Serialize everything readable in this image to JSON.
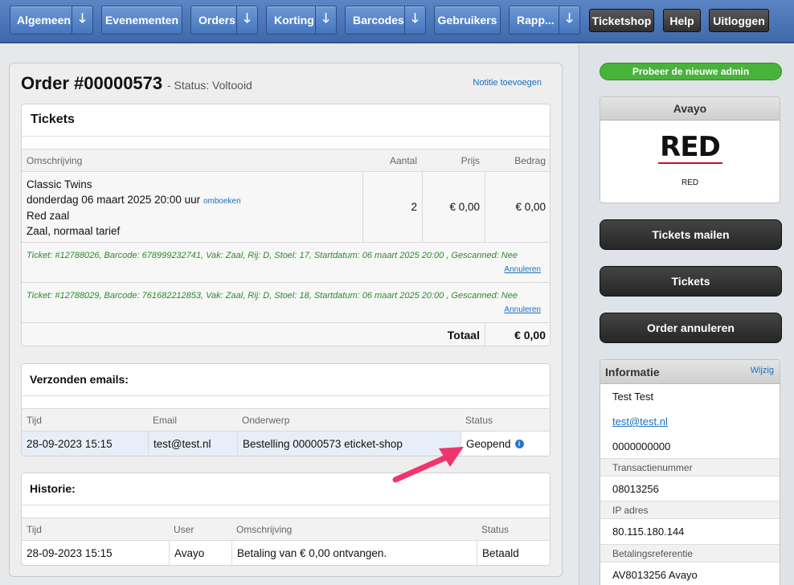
{
  "nav": {
    "algemeen": "Algemeen",
    "evenementen": "Evenementen",
    "orders": "Orders",
    "korting": "Korting",
    "barcodes": "Barcodes",
    "gebruikers": "Gebruikers",
    "rapp": "Rapp...",
    "ticketshop": "Ticketshop",
    "help": "Help",
    "uitloggen": "Uitloggen",
    "arrow": "🡓"
  },
  "order": {
    "title": "Order #00000573",
    "status": "- Status: Voltooid",
    "note_link": "Notitie toevoegen"
  },
  "tickets": {
    "heading": "Tickets",
    "columns": {
      "omschrijving": "Omschrijving",
      "aantal": "Aantal",
      "prijs": "Prijs",
      "bedrag": "Bedrag"
    },
    "item": {
      "name": "Classic Twins",
      "date": "donderdag 06 maart 2025 20:00 uur",
      "rebook": "omboeken",
      "hall": "Red zaal",
      "rate": "Zaal, normaal tarief",
      "aantal": "2",
      "prijs": "€ 0,00",
      "bedrag": "€ 0,00"
    },
    "lines": [
      {
        "text": "Ticket: #12788026, Barcode: 678999232741, Vak: Zaal, Rij: D, Stoel: 17, Startdatum: 06 maart 2025 20:00 , Gescanned: Nee",
        "cancel": "Annuleren"
      },
      {
        "text": "Ticket: #12788029, Barcode: 761682212853, Vak: Zaal, Rij: D, Stoel: 18, Startdatum: 06 maart 2025 20:00 , Gescanned: Nee",
        "cancel": "Annuleren"
      }
    ],
    "total_label": "Totaal",
    "total_value": "€ 0,00"
  },
  "emails": {
    "heading": "Verzonden emails:",
    "columns": {
      "tijd": "Tijd",
      "email": "Email",
      "onderwerp": "Onderwerp",
      "status": "Status"
    },
    "row": {
      "tijd": "28-09-2023 15:15",
      "email": "test@test.nl",
      "onderwerp": "Bestelling 00000573 eticket-shop",
      "status": "Geopend",
      "info_icon": "i"
    }
  },
  "historie": {
    "heading": "Historie:",
    "columns": {
      "tijd": "Tijd",
      "user": "User",
      "omschrijving": "Omschrijving",
      "status": "Status"
    },
    "row": {
      "tijd": "28-09-2023 15:15",
      "user": "Avayo",
      "omschrijving": "Betaling van € 0,00 ontvangen.",
      "status": "Betaald"
    }
  },
  "sidebar": {
    "new_admin": "Probeer de nieuwe admin",
    "org": {
      "name": "Avayo",
      "logo_text": "RED",
      "caption": "RED"
    },
    "buttons": {
      "mail": "Tickets mailen",
      "tickets": "Tickets",
      "cancel": "Order annuleren"
    },
    "info": {
      "heading": "Informatie",
      "edit": "Wijzig",
      "name": "Test Test",
      "email": "test@test.nl",
      "phone": "0000000000",
      "trans_label": "Transactienummer",
      "trans_value": "08013256",
      "ip_label": "IP adres",
      "ip_value": "80.115.180.144",
      "ref_label": "Betalingsreferentie",
      "ref_value": "AV8013256 Avayo"
    }
  },
  "colors": {
    "nav_blue": "#4676be",
    "link": "#1a6fc0",
    "ticket_green": "#2a8a2a",
    "new_admin_green": "#48b33a",
    "arrow_pink": "#f0346e"
  }
}
